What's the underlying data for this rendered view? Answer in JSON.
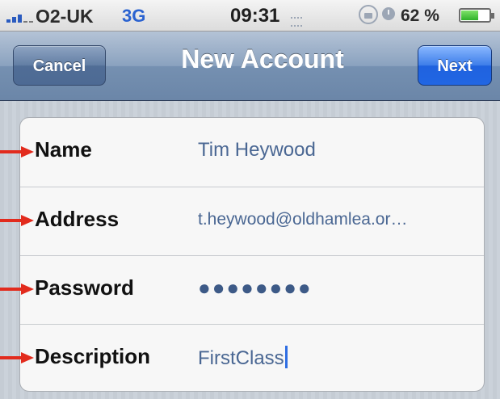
{
  "status_bar": {
    "carrier": "O2-UK",
    "network": "3G",
    "time": "09:31",
    "battery": "62 %",
    "battery_level_percent": 62
  },
  "nav": {
    "cancel_label": "Cancel",
    "title": "New Account",
    "next_label": "Next"
  },
  "form": {
    "rows": [
      {
        "label": "Name",
        "value": "Tim Heywood"
      },
      {
        "label": "Address",
        "value": "t.heywood@oldhamlea.or…"
      },
      {
        "label": "Password",
        "value": "●●●●●●●●"
      },
      {
        "label": "Description",
        "value": "FirstClass"
      }
    ]
  },
  "colors": {
    "accent": "#2166e3",
    "value_text": "#4a6793",
    "arrow": "#e22b1d"
  }
}
